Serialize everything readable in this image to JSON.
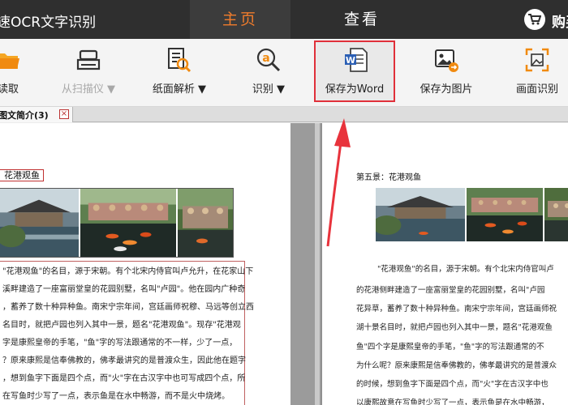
{
  "app": {
    "title": "速OCR文字识别"
  },
  "tabs": [
    {
      "label": "主页"
    },
    {
      "label": "查看"
    }
  ],
  "buy": {
    "label": "购买"
  },
  "toolbar": {
    "items": [
      {
        "label": "读取",
        "icon": "folder-open-icon"
      },
      {
        "label": "从扫描仪 ▼",
        "icon": "scanner-icon",
        "disabled": true
      },
      {
        "label": "纸面解析 ▼",
        "icon": "page-analyze-icon"
      },
      {
        "label": "识别 ▼",
        "icon": "recognize-icon"
      },
      {
        "label": "保存为Word",
        "icon": "word-doc-icon"
      },
      {
        "label": "保存为图片",
        "icon": "save-image-icon"
      },
      {
        "label": "画面识别",
        "icon": "screen-capture-icon"
      }
    ]
  },
  "doc_tab": {
    "label": "图文简介(3)",
    "close": "×"
  },
  "left_page": {
    "heading": "花港观鱼",
    "lines": [
      "\"花港观鱼\"的名目，源于宋朝。有个北宋内侍官叫卢允升，在花家山下",
      "溪畔建造了一座富丽堂皇的花园别墅，名叫\"卢园\"。他在园内广种奇",
      "，蓄养了数十种异种鱼。南宋宁宗年间，宫廷画师祝穆、马远等创立西",
      "名目时，就把卢园也列入其中一景，题名\"花港观鱼\"。现存\"花港观",
      "字是康熙皇帝的手笔，\"鱼\"字的写法跟通常的不一样，少了一点，",
      "？原来康熙是信奉佛教的，佛孝最讲究的是普渡众生，因此他在题字",
      "，想到鱼字下面是四个点，而\"火\"字在古汉字中也可写成四个点，所",
      "在写鱼时少写了一点，表示鱼是在水中畅游，而不是火中烧烤。"
    ]
  },
  "right_page": {
    "heading": "第五景：花港观鱼",
    "lines": [
      "\"花港观鱼\"的名目，源于宋朝。有个北宋内侍官叫卢",
      "的花港侧畔建造了一座富丽堂皇的花园别墅，名叫\"卢园",
      "花异草，蓄养了数十种异种鱼。南宋宁宗年间，宫廷画师祝",
      "湖十景名目时，就把卢园也列入其中一景，题名\"花港观鱼",
      "鱼\"四个字是康熙皇帝的手笔，\"鱼\"字的写法跟通常的不",
      "为什么呢？原来康熙是信奉佛教的，佛孝最讲究的是普渡众",
      "的时候，想到鱼字下面是四个点，而\"火\"字在古汉字中也",
      "以康熙故意在写鱼时少写了一点，表示鱼是在水中畅游，"
    ]
  },
  "colors": {
    "titlebar": "#2f2f2f",
    "active_tab_text": "#f07c2c",
    "highlight_border": "#e0303a",
    "annotation_arrow": "#e8333c"
  }
}
